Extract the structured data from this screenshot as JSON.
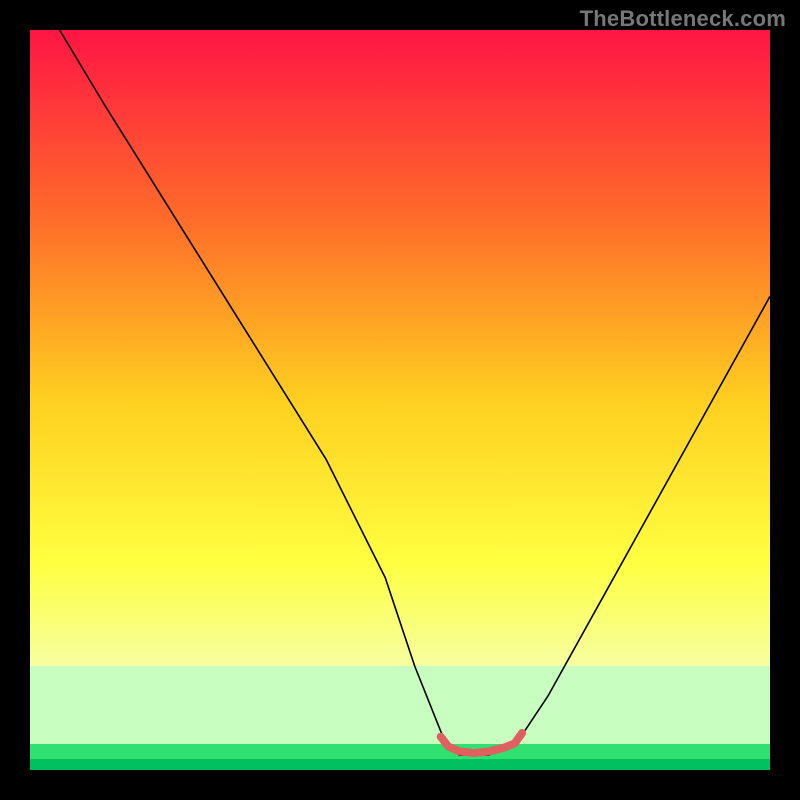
{
  "watermark": "TheBottleneck.com",
  "chart_data": {
    "type": "line",
    "title": "",
    "xlabel": "",
    "ylabel": "",
    "xlim": [
      0,
      100
    ],
    "ylim": [
      0,
      100
    ],
    "grid": false,
    "legend": false,
    "series": [
      {
        "name": "bottleneck-curve",
        "x": [
          4,
          10,
          20,
          30,
          40,
          48,
          52,
          56,
          58,
          62,
          66,
          70,
          80,
          90,
          100
        ],
        "y": [
          100,
          90,
          74,
          58,
          42,
          26,
          14,
          4,
          2,
          2,
          4,
          10,
          28,
          46,
          64
        ],
        "color": "#000000"
      },
      {
        "name": "optimal-zone-marker",
        "x": [
          55.5,
          56.5,
          58,
          60,
          62,
          64,
          65.5,
          66.5
        ],
        "y": [
          4.5,
          3.2,
          2.5,
          2.3,
          2.5,
          3.0,
          3.6,
          5.0
        ],
        "color": "#e06060"
      }
    ],
    "background_gradient_stops": [
      {
        "pos": 0.0,
        "color": "#ff1545"
      },
      {
        "pos": 0.25,
        "color": "#ff6a2a"
      },
      {
        "pos": 0.5,
        "color": "#ffcf20"
      },
      {
        "pos": 0.72,
        "color": "#ffff40"
      },
      {
        "pos": 0.86,
        "color": "#f6ffa0"
      },
      {
        "pos": 0.965,
        "color": "#c8ffc0"
      },
      {
        "pos": 0.985,
        "color": "#30e070"
      },
      {
        "pos": 1.0,
        "color": "#00c060"
      }
    ]
  }
}
